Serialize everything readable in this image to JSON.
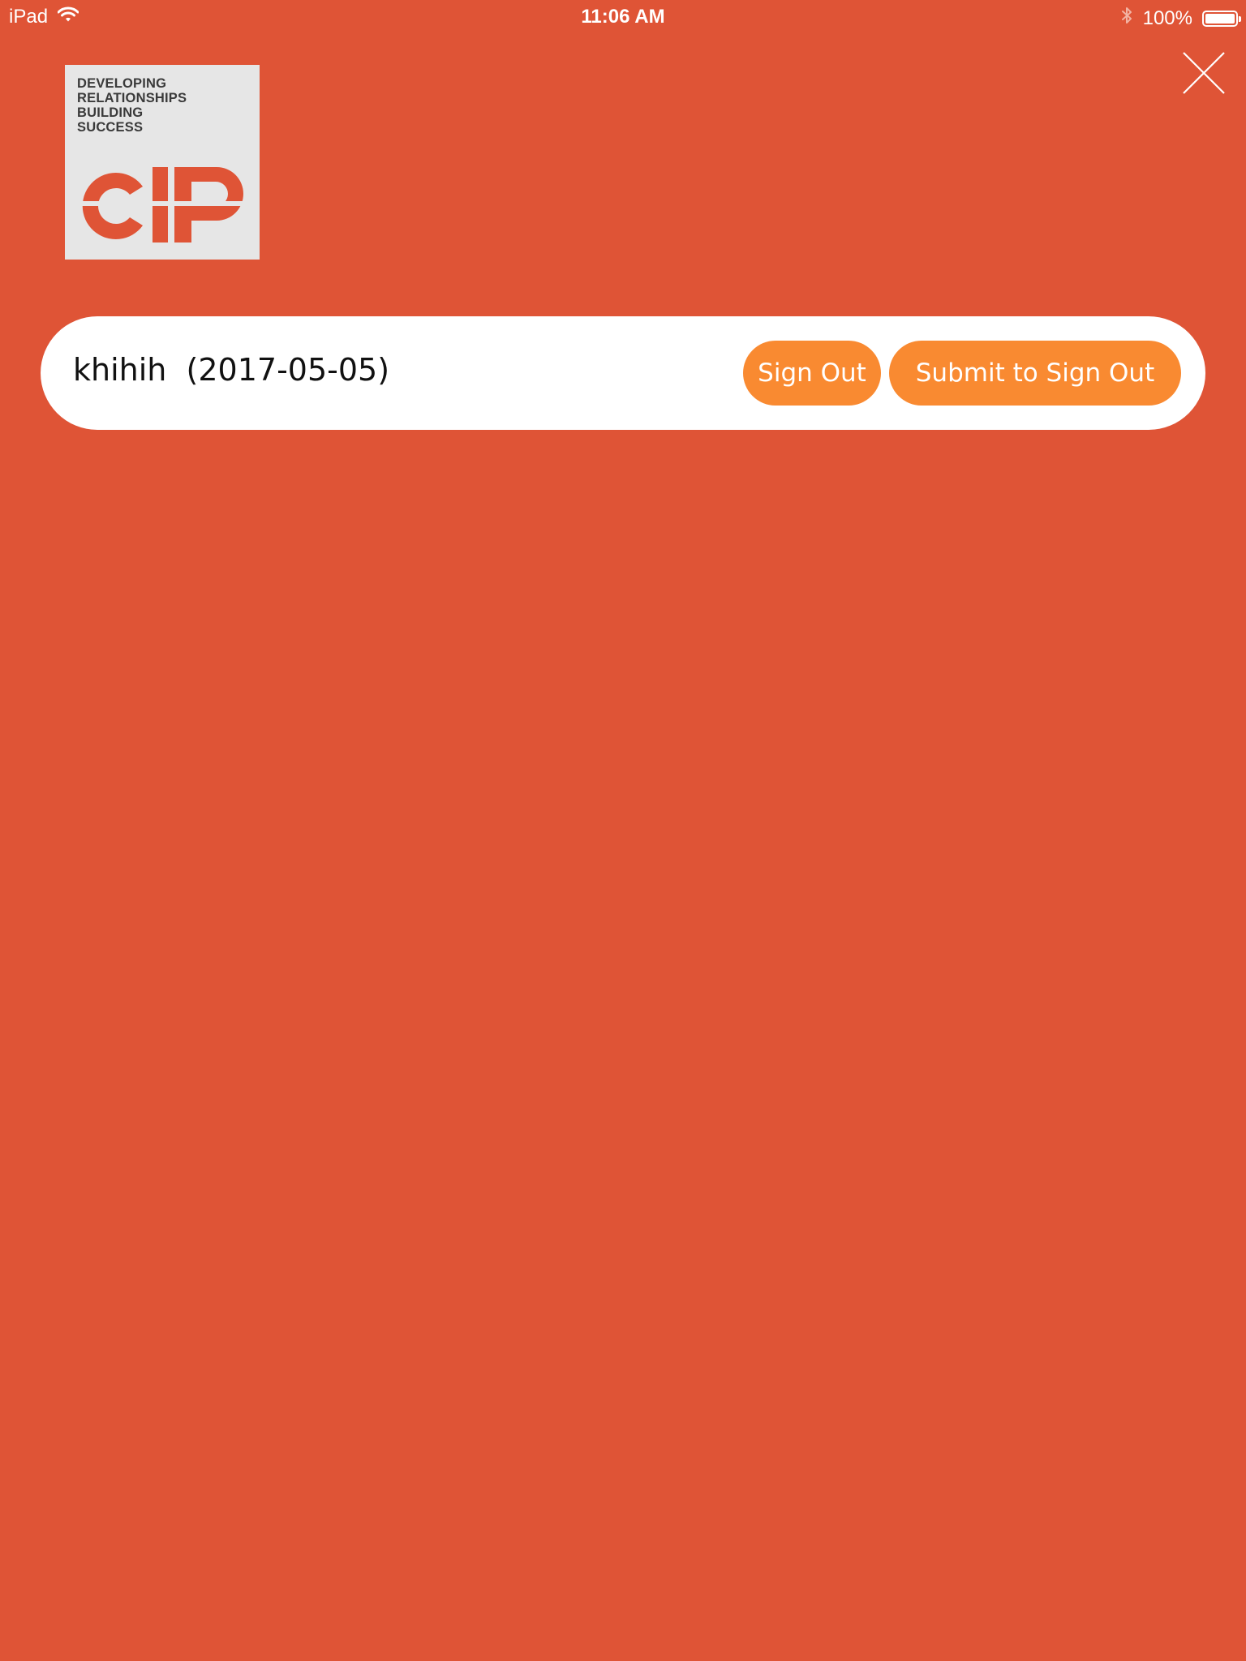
{
  "status_bar": {
    "device": "iPad",
    "time": "11:06 AM",
    "battery_text": "100%",
    "battery_level": 1.0,
    "icons": [
      "wifi-icon",
      "bluetooth-icon",
      "battery-icon"
    ]
  },
  "logo": {
    "tagline": [
      "DEVELOPING",
      "RELATIONSHIPS",
      "BUILDING",
      "SUCCESS"
    ],
    "mark": "CIP"
  },
  "entry": {
    "name_date": "khihih  (2017-05-05)",
    "sign_out_label": "Sign Out",
    "submit_label": "Submit to Sign Out"
  },
  "close_icon": "close-icon",
  "colors": {
    "background": "#df5436",
    "accent_button": "#f98a31",
    "row_background": "#ffffff",
    "logo_background": "#e6e6e6",
    "logo_text": "#3a3a3a"
  }
}
